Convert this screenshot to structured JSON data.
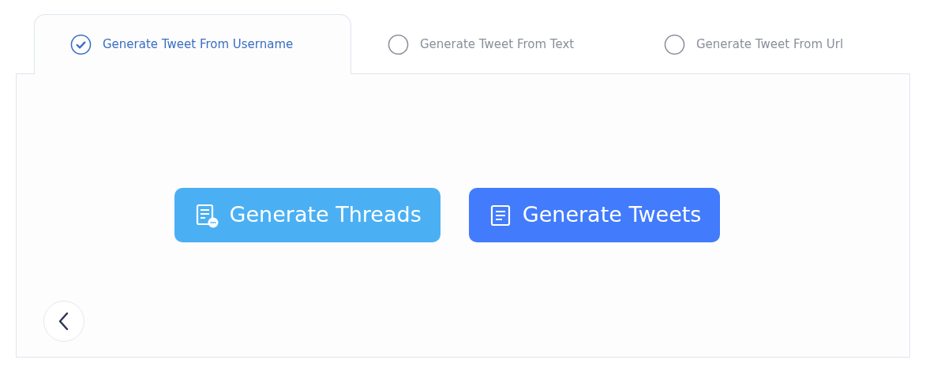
{
  "tabs": [
    {
      "label": "Generate Tweet From Username",
      "selected": true
    },
    {
      "label": "Generate Tweet From Text",
      "selected": false
    },
    {
      "label": "Generate Tweet From Url",
      "selected": false
    }
  ],
  "actions": [
    {
      "label": "Generate Threads",
      "kind": "threads",
      "color": "#4bb0f3"
    },
    {
      "label": "Generate Tweets",
      "kind": "tweets",
      "color": "#427bfc"
    }
  ]
}
